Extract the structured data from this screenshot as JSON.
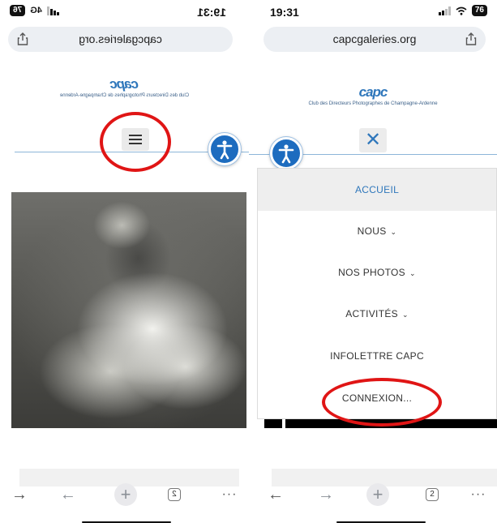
{
  "left_screen": {
    "status": {
      "time": "19:31",
      "network": "4G",
      "battery": "76"
    },
    "url": "capcgaleries.org",
    "logo": {
      "mark": "capc",
      "subtitle": "Club des Directeurs Photographes de Champagne-Ardenne"
    },
    "tabs_count": "2"
  },
  "right_screen": {
    "status": {
      "time": "19:31",
      "battery": "76"
    },
    "url": "capcgaleries.org",
    "logo": {
      "mark": "capc",
      "subtitle": "Club des Directeurs Photographes de Champagne-Ardenne"
    },
    "close_glyph": "✕",
    "menu": {
      "accueil": "ACCUEIL",
      "nous": "NOUS",
      "nos_photos": "NOS PHOTOS",
      "activites": "ACTIVITÉS",
      "infolettre": "INFOLETTRE CAPC",
      "connexion": "CONNEXION..."
    },
    "caret_glyph": "⌄",
    "tabs_count": "2"
  },
  "glyphs": {
    "more": "···",
    "plus": "+",
    "back": "←",
    "forward": "→"
  },
  "colors": {
    "accent": "#2f77bb",
    "accessibility_button": "#1d6cbf",
    "highlight_circle": "#e01515"
  },
  "icons": [
    "share-icon",
    "hamburger-menu-icon",
    "close-icon",
    "accessibility-icon",
    "more-icon",
    "tabs-icon",
    "new-tab-icon",
    "back-arrow-icon",
    "forward-arrow-icon"
  ]
}
